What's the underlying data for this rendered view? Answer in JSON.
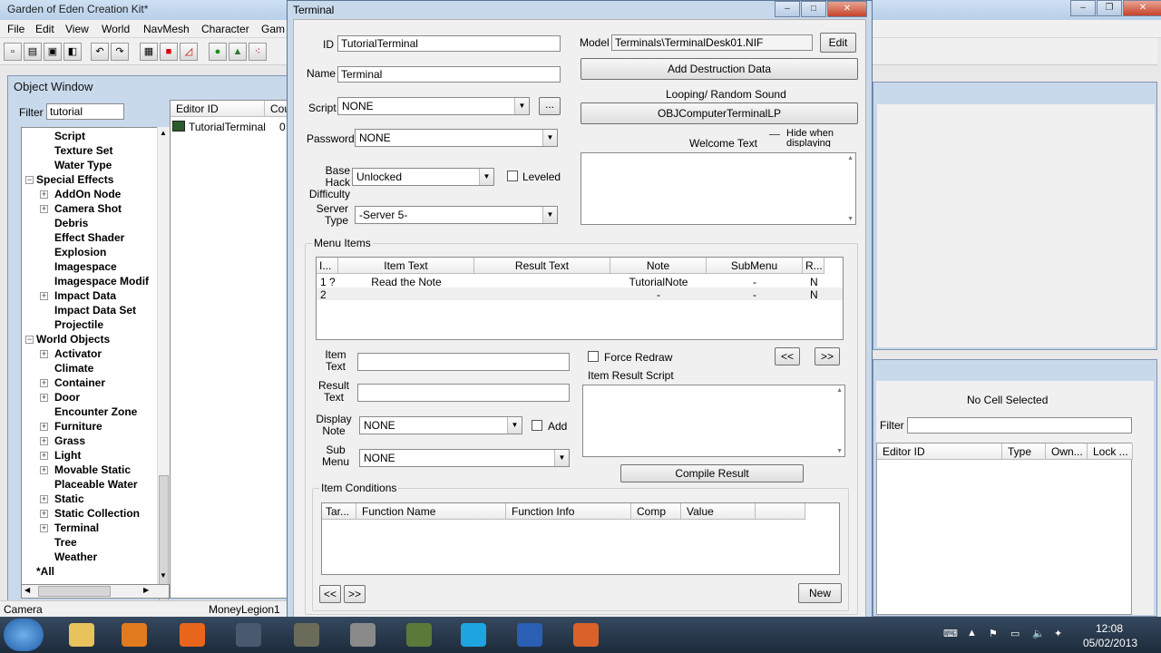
{
  "app": {
    "title": "Garden of Eden Creation Kit*"
  },
  "menubar": [
    "File",
    "Edit",
    "View",
    "World",
    "NavMesh",
    "Character",
    "Gam"
  ],
  "object_window": {
    "title": "Object Window",
    "filter_label": "Filter",
    "filter_value": "tutorial",
    "tree": [
      {
        "label": "Script",
        "level": 2,
        "expander": ""
      },
      {
        "label": "Texture Set",
        "level": 2,
        "expander": ""
      },
      {
        "label": "Water Type",
        "level": 2,
        "expander": ""
      },
      {
        "label": "Special Effects",
        "level": 1,
        "expander": "−"
      },
      {
        "label": "AddOn Node",
        "level": 2,
        "expander": "+"
      },
      {
        "label": "Camera Shot",
        "level": 2,
        "expander": "+"
      },
      {
        "label": "Debris",
        "level": 2,
        "expander": ""
      },
      {
        "label": "Effect Shader",
        "level": 2,
        "expander": ""
      },
      {
        "label": "Explosion",
        "level": 2,
        "expander": ""
      },
      {
        "label": "Imagespace",
        "level": 2,
        "expander": ""
      },
      {
        "label": "Imagespace Modif",
        "level": 2,
        "expander": ""
      },
      {
        "label": "Impact Data",
        "level": 2,
        "expander": "+"
      },
      {
        "label": "Impact Data Set",
        "level": 2,
        "expander": ""
      },
      {
        "label": "Projectile",
        "level": 2,
        "expander": ""
      },
      {
        "label": "World Objects",
        "level": 1,
        "expander": "−"
      },
      {
        "label": "Activator",
        "level": 2,
        "expander": "+"
      },
      {
        "label": "Climate",
        "level": 2,
        "expander": ""
      },
      {
        "label": "Container",
        "level": 2,
        "expander": "+"
      },
      {
        "label": "Door",
        "level": 2,
        "expander": "+"
      },
      {
        "label": "Encounter Zone",
        "level": 2,
        "expander": ""
      },
      {
        "label": "Furniture",
        "level": 2,
        "expander": "+"
      },
      {
        "label": "Grass",
        "level": 2,
        "expander": "+"
      },
      {
        "label": "Light",
        "level": 2,
        "expander": "+"
      },
      {
        "label": "Movable Static",
        "level": 2,
        "expander": "+"
      },
      {
        "label": "Placeable Water",
        "level": 2,
        "expander": ""
      },
      {
        "label": "Static",
        "level": 2,
        "expander": "+"
      },
      {
        "label": "Static Collection",
        "level": 2,
        "expander": "+"
      },
      {
        "label": "Terminal",
        "level": 2,
        "expander": "+"
      },
      {
        "label": "Tree",
        "level": 2,
        "expander": ""
      },
      {
        "label": "Weather",
        "level": 2,
        "expander": ""
      },
      {
        "label": "*All",
        "level": 1,
        "expander": ""
      }
    ],
    "list_headers": [
      "Editor ID",
      "Cou"
    ],
    "list_rows": [
      {
        "id": "TutorialTerminal",
        "count": "0"
      }
    ]
  },
  "status": {
    "left": "Camera",
    "mid": "MoneyLegion1"
  },
  "terminal": {
    "title": "Terminal",
    "id_label": "ID",
    "id_value": "TutorialTerminal",
    "name_label": "Name",
    "name_value": "Terminal",
    "script_label": "Script",
    "script_value": "NONE",
    "script_btn": "...",
    "password_label": "Password",
    "password_value": "NONE",
    "hack_label": "Base Hack\nDifficulty",
    "hack_value": "Unlocked",
    "leveled_label": "Leveled",
    "server_label": "Server\nType",
    "server_value": "-Server 5-",
    "model_label": "Model",
    "model_value": "Terminals\\TerminalDesk01.NIF",
    "edit_btn": "Edit",
    "destruction_btn": "Add Destruction Data",
    "sound_label": "Looping/ Random Sound",
    "sound_btn": "OBJComputerTerminalLP",
    "welcome_label": "Welcome Text",
    "hide_label": "Hide when displaying image",
    "menu_items_label": "Menu Items",
    "menu_headers": [
      "I...",
      "Item Text",
      "Result Text",
      "Note",
      "SubMenu",
      "R..."
    ],
    "menu_rows": [
      {
        "index": "1 ?",
        "text": "Read the Note",
        "result": "",
        "note": "TutorialNote",
        "submenu": "-",
        "r": "N"
      },
      {
        "index": "2",
        "text": "",
        "result": "",
        "note": "-",
        "submenu": "-",
        "r": "N"
      }
    ],
    "item_text_label": "Item\nText",
    "result_text_label": "Result\nText",
    "display_note_label": "Display\nNote",
    "display_note_value": "NONE",
    "add_label": "Add",
    "submenu_label": "Sub\nMenu",
    "submenu_value": "NONE",
    "force_redraw_label": "Force Redraw",
    "prev_btn": "<<",
    "next_btn": ">>",
    "result_script_label": "Item Result Script",
    "compile_btn": "Compile Result",
    "conditions_label": "Item Conditions",
    "condition_headers": [
      "Tar...",
      "Function Name",
      "Function Info",
      "Comp",
      "Value",
      ""
    ],
    "new_btn": "New"
  },
  "cell_view": {
    "no_cell": "No Cell Selected",
    "filter_label": "Filter",
    "headers": [
      "Editor ID",
      "Type",
      "Own...",
      "Lock ..."
    ]
  },
  "taskbar": {
    "time": "12:08",
    "date": "05/02/2013",
    "apps": [
      {
        "name": "start-button",
        "color": "#3a7bd5"
      },
      {
        "name": "explorer",
        "color": "#e8c25a"
      },
      {
        "name": "media-player",
        "color": "#e07b1f"
      },
      {
        "name": "firefox",
        "color": "#e8661c"
      },
      {
        "name": "steam",
        "color": "#4a5a6e"
      },
      {
        "name": "gimp",
        "color": "#6b6b5a"
      },
      {
        "name": "geck-tool",
        "color": "#8a8a8a"
      },
      {
        "name": "fallout-launcher",
        "color": "#5a7a3a"
      },
      {
        "name": "skype",
        "color": "#1ea5e0"
      },
      {
        "name": "word",
        "color": "#2b5fb4"
      },
      {
        "name": "briefcase",
        "color": "#d9622b"
      }
    ]
  }
}
